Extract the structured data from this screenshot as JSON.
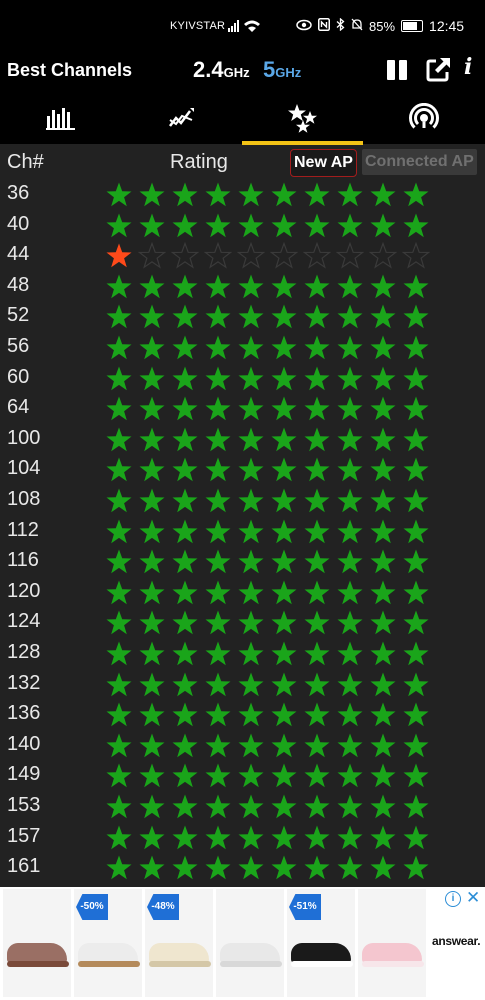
{
  "status_bar": {
    "carrier": "KYIVSTAR",
    "battery": "85%",
    "time": "12:45"
  },
  "app_bar": {
    "title": "Best Channels",
    "band_24": "2.4",
    "band_24_unit": "GHz",
    "band_5": "5",
    "band_5_unit": "GHz",
    "band_5_color": "#5ba8e8",
    "info_label": "i"
  },
  "tabs": {
    "items": [
      {
        "icon": "bar-chart-icon"
      },
      {
        "icon": "time-graph-icon"
      },
      {
        "icon": "stars-icon",
        "selected": true
      },
      {
        "icon": "access-point-icon"
      }
    ],
    "accent": "#f3c316"
  },
  "header": {
    "col_channel": "Ch#",
    "col_rating": "Rating",
    "new_ap": "New AP",
    "connected_ap": "Connected AP"
  },
  "rating_max": 10,
  "channels": [
    {
      "ch": "36",
      "rating": 10
    },
    {
      "ch": "40",
      "rating": 10
    },
    {
      "ch": "44",
      "rating": 1
    },
    {
      "ch": "48",
      "rating": 10
    },
    {
      "ch": "52",
      "rating": 10
    },
    {
      "ch": "56",
      "rating": 10
    },
    {
      "ch": "60",
      "rating": 10
    },
    {
      "ch": "64",
      "rating": 10
    },
    {
      "ch": "100",
      "rating": 10
    },
    {
      "ch": "104",
      "rating": 10
    },
    {
      "ch": "108",
      "rating": 10
    },
    {
      "ch": "112",
      "rating": 10
    },
    {
      "ch": "116",
      "rating": 10
    },
    {
      "ch": "120",
      "rating": 10
    },
    {
      "ch": "124",
      "rating": 10
    },
    {
      "ch": "128",
      "rating": 10
    },
    {
      "ch": "132",
      "rating": 10
    },
    {
      "ch": "136",
      "rating": 10
    },
    {
      "ch": "140",
      "rating": 10
    },
    {
      "ch": "149",
      "rating": 10
    },
    {
      "ch": "153",
      "rating": 10
    },
    {
      "ch": "157",
      "rating": 10
    },
    {
      "ch": "161",
      "rating": 10
    }
  ],
  "colors": {
    "star_good": "#1aa51a",
    "star_bad": "#ff4a1a",
    "star_empty_stroke": "#3a3a3a"
  },
  "ad": {
    "products": [
      {
        "badge": "",
        "color": "#9a6f64",
        "sole": "#7a4a3a"
      },
      {
        "badge": "-50%",
        "color": "#ececec",
        "sole": "#b48a5b"
      },
      {
        "badge": "-48%",
        "color": "#efe6cf",
        "sole": "#d4c7a7"
      },
      {
        "badge": "",
        "color": "#e8e8e8",
        "sole": "#d8d8d8"
      },
      {
        "badge": "-51%",
        "color": "#1a1a1a",
        "sole": "#ffffff"
      },
      {
        "badge": "",
        "color": "#f4c6cf",
        "sole": "#f7e6ea"
      }
    ],
    "brand": "answear."
  }
}
